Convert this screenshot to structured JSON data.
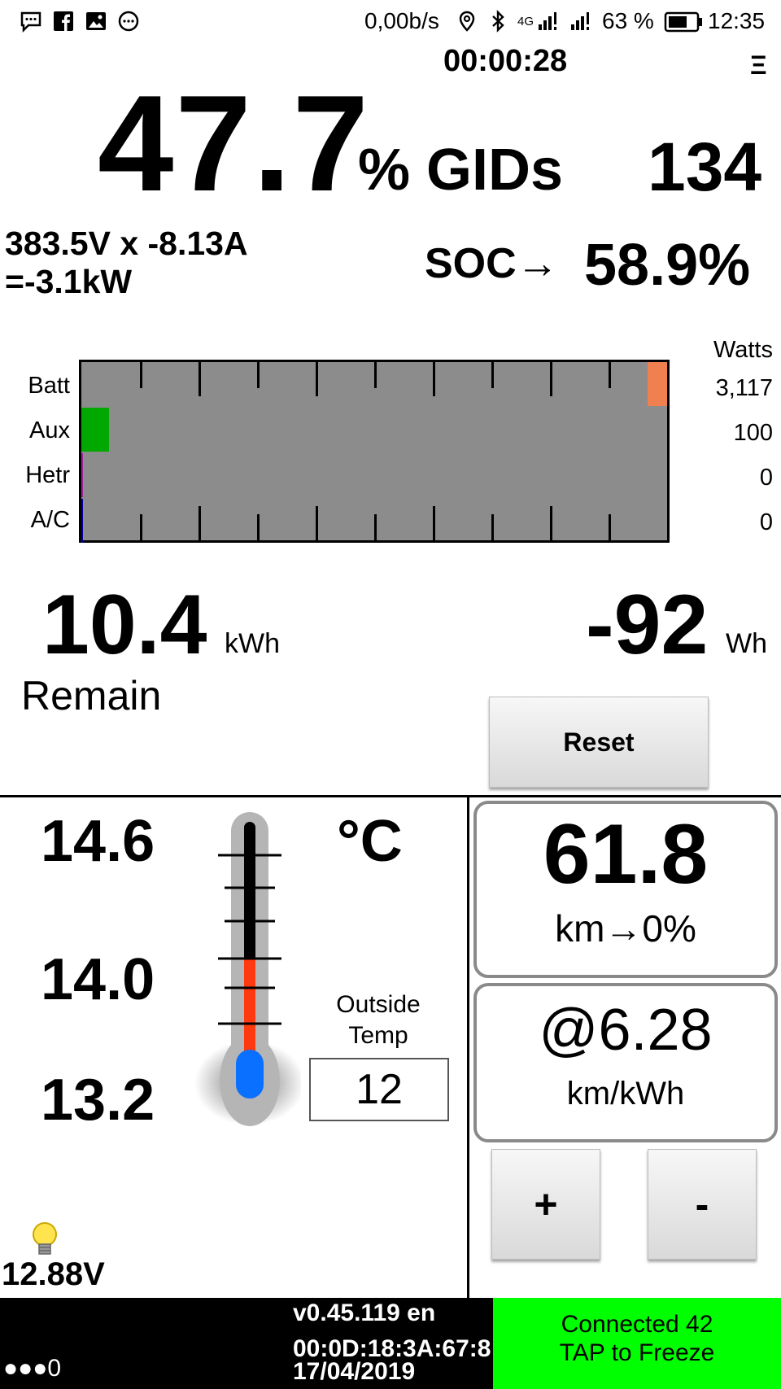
{
  "status_bar": {
    "net_speed": "0,00b/s",
    "network": "4G",
    "battery_percent": "63 %",
    "clock": "12:35",
    "icons": [
      "message-icon",
      "facebook-icon",
      "image-icon",
      "more-icon",
      "location-icon",
      "bluetooth-icon",
      "signal-icon",
      "signal-icon-2",
      "battery-icon"
    ]
  },
  "header": {
    "timer": "00:00:28",
    "menu_glyph": "Ξ"
  },
  "gids": {
    "percent": "47.7",
    "label": "% GIDs",
    "count": "134"
  },
  "power": {
    "line1": "383.5V x -8.13A",
    "line2": "=-3.1kW"
  },
  "soc": {
    "label": "SOC→",
    "value": "58.9%"
  },
  "graph": {
    "watts_header": "Watts",
    "rows": [
      {
        "label": "Batt",
        "watts": "3,117",
        "color": "#f08050"
      },
      {
        "label": "Aux",
        "watts": "100",
        "color": "#00a800"
      },
      {
        "label": "Hetr",
        "watts": "0",
        "color": "#a020a0"
      },
      {
        "label": "A/C",
        "watts": "0",
        "color": "#0000a0"
      }
    ]
  },
  "energy": {
    "remain_value": "10.4",
    "remain_unit": "kWh",
    "remain_label": "Remain",
    "used_value": "-92",
    "used_unit": "Wh",
    "reset_label": "Reset"
  },
  "temperature": {
    "high": "14.6",
    "mid": "14.0",
    "low": "13.2",
    "unit": "°C",
    "outside_label_1": "Outside",
    "outside_label_2": "Temp",
    "outside_value": "12",
    "thermometer_fill_fraction": 0.4
  },
  "range": {
    "value": "61.8",
    "label": "km→0%"
  },
  "efficiency": {
    "value": "@6.28",
    "unit": "km/kWh",
    "plus_label": "+",
    "minus_label": "-"
  },
  "aux_battery": {
    "voltage": "12.88V"
  },
  "footer": {
    "dots": "●●●0",
    "version": "v0.45.119 en",
    "mac": "00:0D:18:3A:67:8",
    "date": "17/04/2019",
    "connected": "Connected 42",
    "tap": "TAP to Freeze",
    "connected_color": "#00ff00"
  }
}
